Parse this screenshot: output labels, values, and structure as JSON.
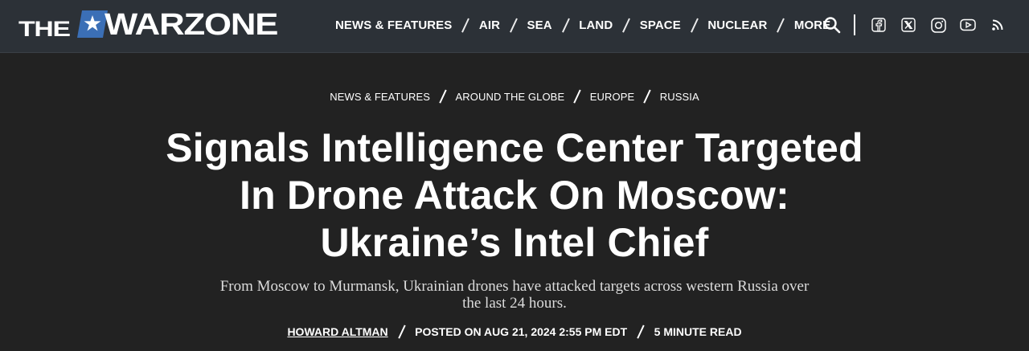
{
  "header": {
    "logo_the": "THE",
    "logo_name": "WARZONE",
    "nav": [
      {
        "label": "NEWS & FEATURES"
      },
      {
        "label": "AIR"
      },
      {
        "label": "SEA"
      },
      {
        "label": "LAND"
      },
      {
        "label": "SPACE"
      },
      {
        "label": "NUCLEAR"
      },
      {
        "label": "MORE"
      }
    ],
    "icons": [
      "search-icon",
      "facebook-icon",
      "x-icon",
      "instagram-icon",
      "youtube-icon",
      "rss-icon"
    ]
  },
  "article": {
    "breadcrumbs": [
      {
        "label": "NEWS & FEATURES"
      },
      {
        "label": "AROUND THE GLOBE"
      },
      {
        "label": "EUROPE"
      },
      {
        "label": "RUSSIA"
      }
    ],
    "title": "Signals Intelligence Center Targeted In Drone Attack On Moscow: Ukraine’s Intel Chief",
    "dek": "From Moscow to Murmansk, Ukrainian drones have attacked targets across western Russia over the last 24 hours.",
    "author": "HOWARD ALTMAN",
    "posted": "POSTED ON AUG 21, 2024 2:55 PM EDT",
    "read_time": "5 MINUTE READ"
  },
  "colors": {
    "header_bg": "#2c3137",
    "page_bg": "#222222",
    "logo_star_bg": "#3b6fb6"
  }
}
